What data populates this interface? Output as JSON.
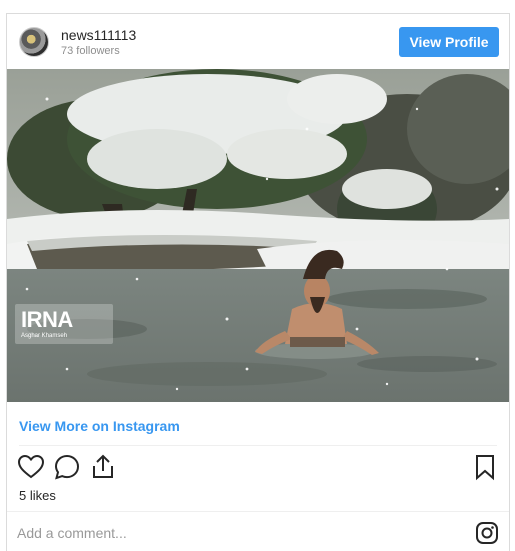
{
  "header": {
    "username": "news111113",
    "followers": "73 followers",
    "view_profile_label": "View Profile"
  },
  "photo": {
    "watermark_text": "IRNA",
    "watermark_credit": "Asghar Khamseh"
  },
  "links": {
    "view_more": "View More on Instagram"
  },
  "actions": {
    "like_icon": "heart-icon",
    "comment_icon": "comment-icon",
    "share_icon": "share-icon",
    "save_icon": "bookmark-icon"
  },
  "likes": "5 likes",
  "comment": {
    "placeholder": "Add a comment..."
  },
  "colors": {
    "accent": "#3897f0",
    "text": "#262626",
    "muted": "#8e8e8e",
    "border": "#dbdbdb"
  }
}
